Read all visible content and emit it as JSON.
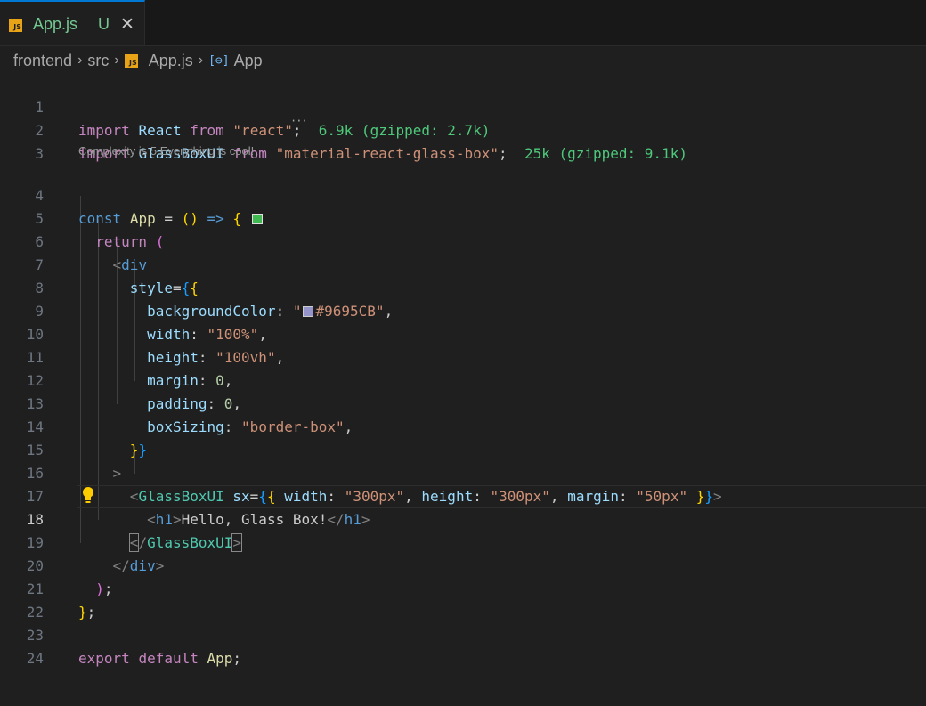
{
  "tab": {
    "title": "App.js",
    "status": "U",
    "close": "✕",
    "icon": "JS"
  },
  "breadcrumb": {
    "items": [
      "frontend",
      "src",
      "App.js",
      "App"
    ]
  },
  "codelens": "Complexity is 5 Everything is cool!",
  "editor": {
    "current_line": 18,
    "lines": [
      "1",
      "2",
      "3",
      "4",
      "5",
      "6",
      "7",
      "8",
      "9",
      "10",
      "11",
      "12",
      "13",
      "14",
      "15",
      "16",
      "17",
      "18",
      "19",
      "20",
      "21",
      "22",
      "23",
      "24"
    ],
    "import_sizes": [
      "6.9k (gzipped: 2.7k)",
      "25k (gzipped: 9.1k)"
    ],
    "strings": {
      "react": "\"react\"",
      "glassbox": "\"material-react-glass-box\"",
      "color": "#9695CB",
      "width": "\"100%\"",
      "height": "\"100vh\"",
      "boxSizing": "\"border-box\"",
      "w300": "\"300px\"",
      "h300": "\"300px\"",
      "m50": "\"50px\"",
      "h1": "Hello, Glass Box!"
    },
    "colors": {
      "swatch": "#9695CB",
      "complexity_ok": "#3fb950"
    }
  }
}
